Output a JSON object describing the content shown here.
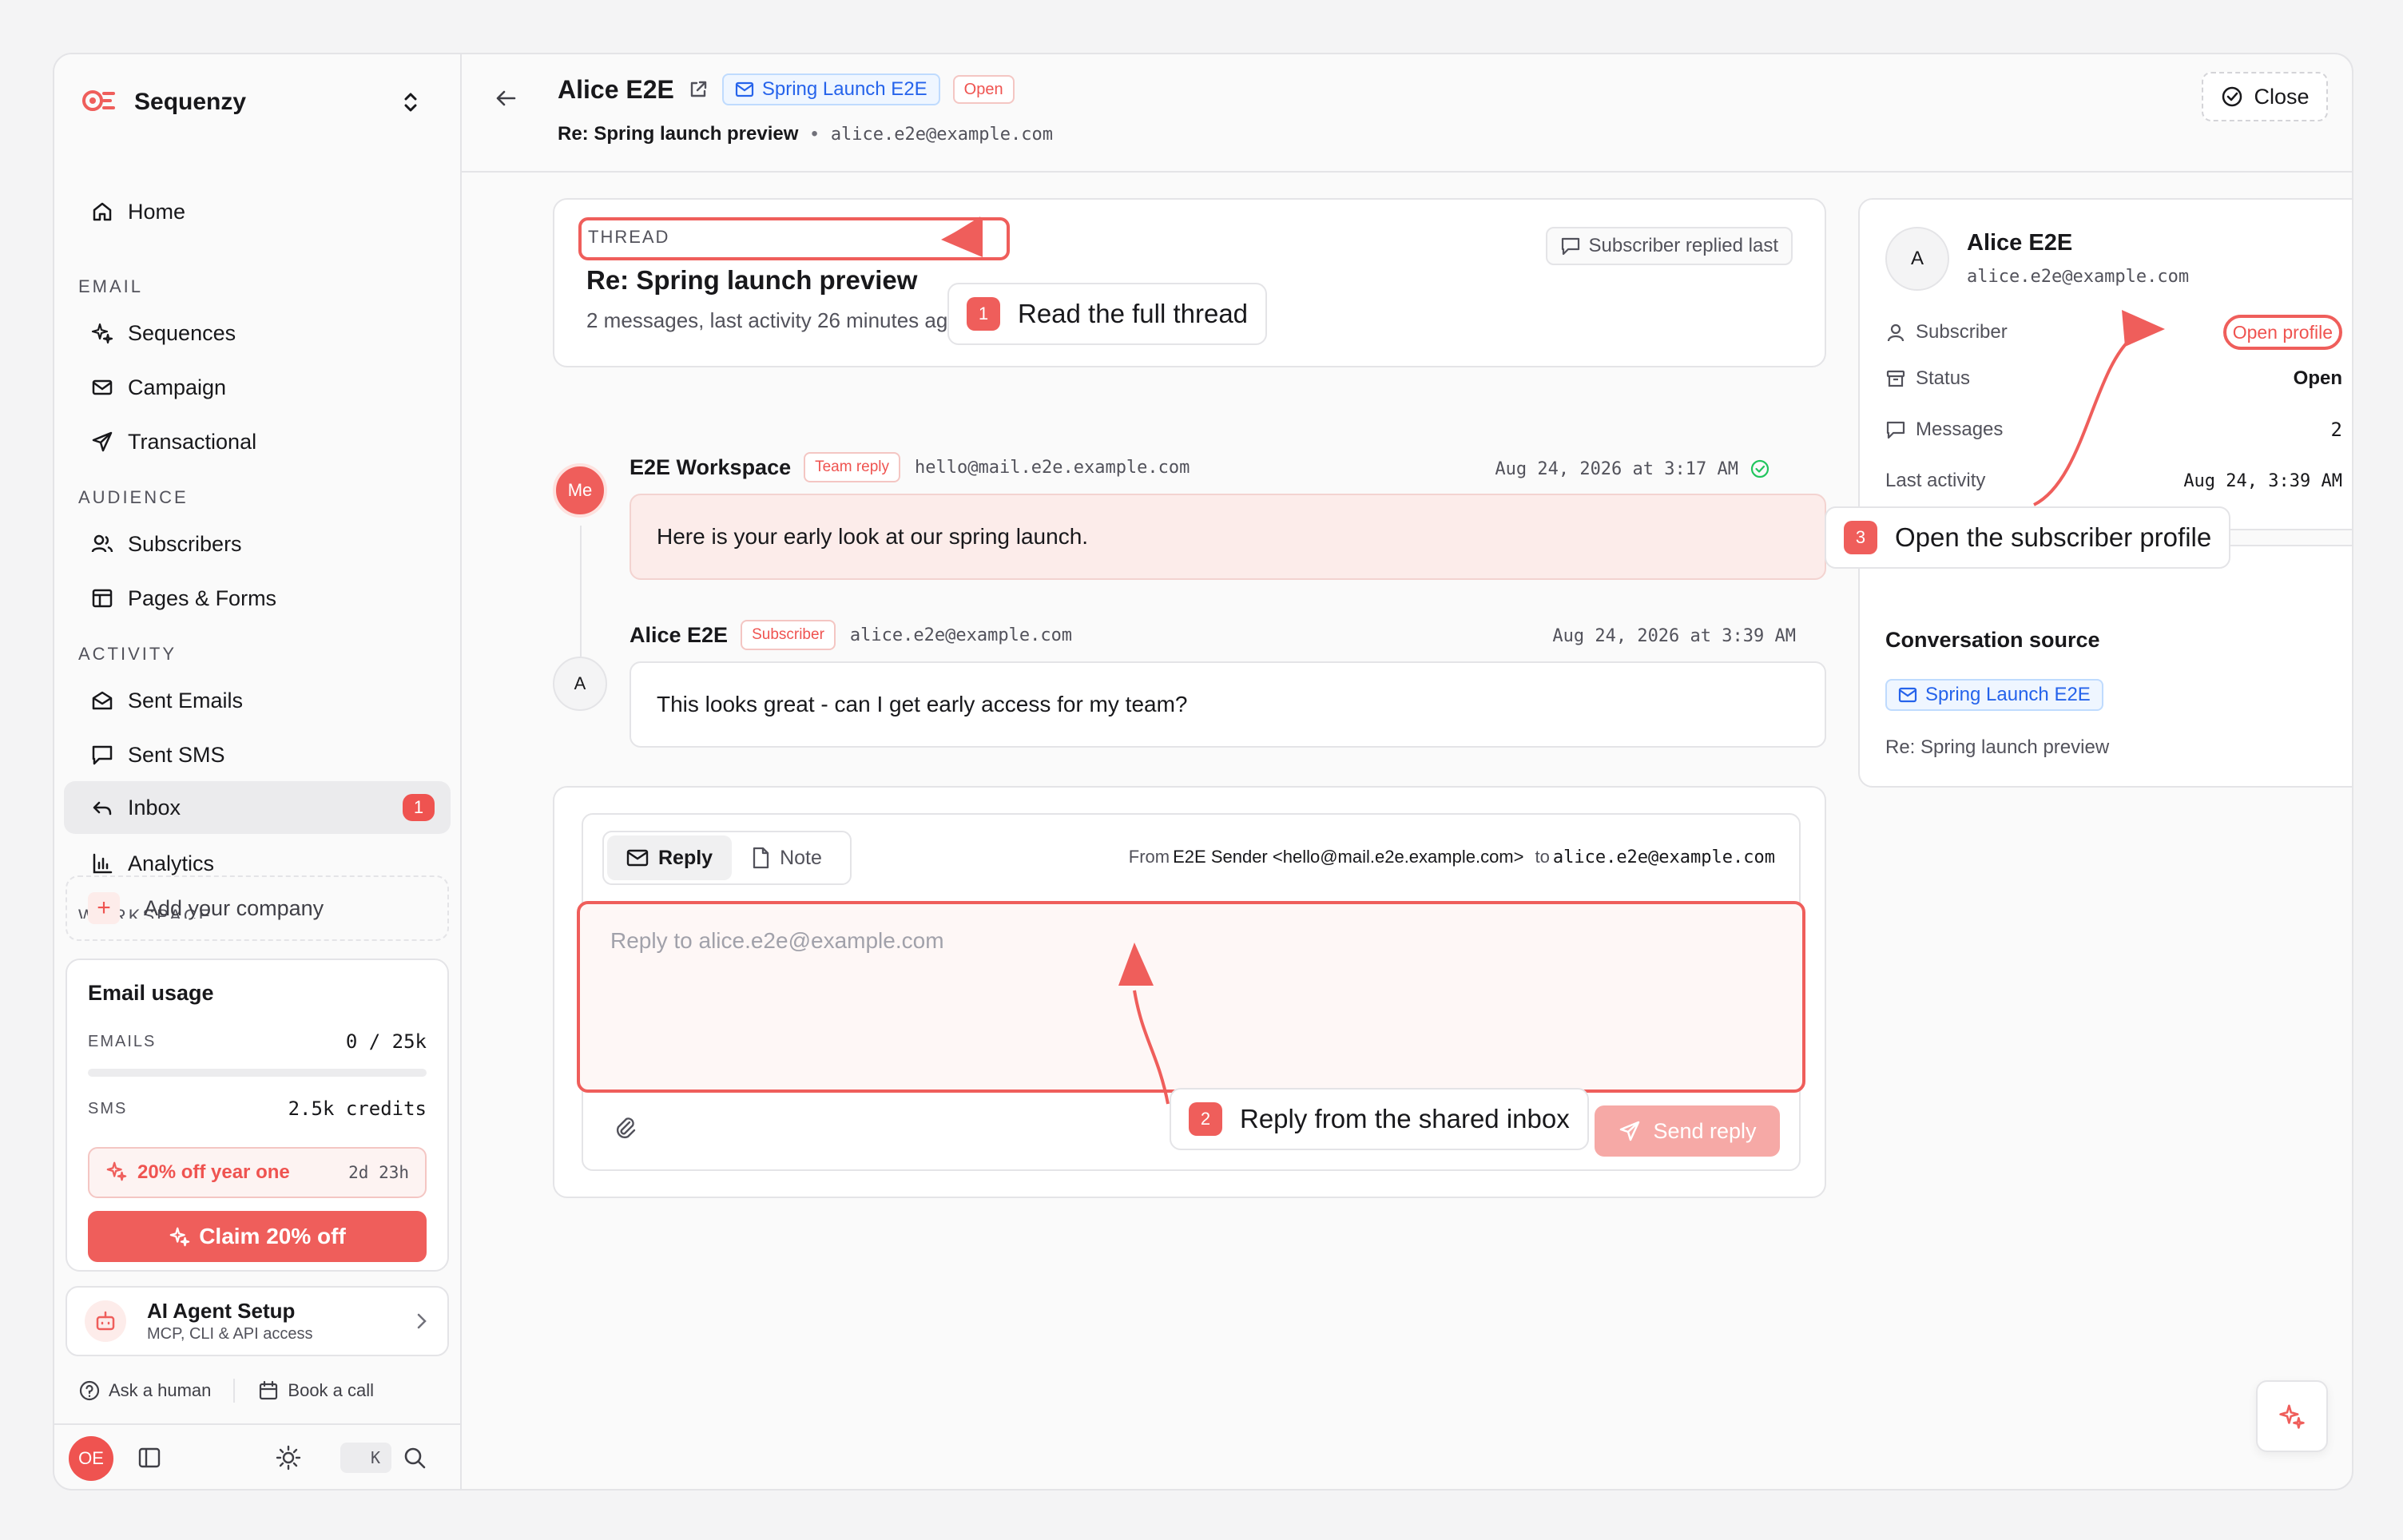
{
  "brand": {
    "name": "Sequenzy"
  },
  "sidebar": {
    "home": "Home",
    "sections": {
      "email": "EMAIL",
      "audience": "AUDIENCE",
      "activity": "ACTIVITY",
      "workspace": "WORKSPACE"
    },
    "email_items": [
      "Sequences",
      "Campaign",
      "Transactional"
    ],
    "audience_items": [
      "Subscribers",
      "Pages & Forms"
    ],
    "activity_items": [
      "Sent Emails",
      "Sent SMS",
      "Inbox",
      "Analytics"
    ],
    "inbox_badge": "1",
    "add_company": "Add your company",
    "usage": {
      "title": "Email usage",
      "emails_label": "EMAILS",
      "emails_value": "0 / 25k",
      "emails_fraction": 0,
      "sms_label": "SMS",
      "sms_value": "2.5k credits",
      "promo": "20% off year one",
      "promo_time": "2d 23h",
      "claim": "Claim 20% off"
    },
    "agent": {
      "title": "AI Agent Setup",
      "subtitle": "MCP, CLI & API access"
    },
    "ask_human": "Ask a human",
    "book_call": "Book a call",
    "avatar": "OE",
    "kbd": "K"
  },
  "header": {
    "title": "Alice E2E",
    "campaign_chip": "Spring Launch E2E",
    "status_chip": "Open",
    "subject": "Re: Spring launch preview",
    "email": "alice.e2e@example.com",
    "close": "Close"
  },
  "thread": {
    "label": "THREAD",
    "title": "Re: Spring launch preview",
    "meta": "2 messages, last activity 26 minutes ago",
    "replied_chip": "Subscriber replied last"
  },
  "messages": [
    {
      "avatar": "Me",
      "name": "E2E Workspace",
      "tag": "Team reply",
      "email": "hello@mail.e2e.example.com",
      "time": "Aug 24, 2026 at 3:17 AM",
      "body": "Here is your early look at our spring launch."
    },
    {
      "avatar": "A",
      "name": "Alice E2E",
      "tag": "Subscriber",
      "email": "alice.e2e@example.com",
      "time": "Aug 24, 2026 at 3:39 AM",
      "body": "This looks great - can I get early access for my team?"
    }
  ],
  "composer": {
    "tab_reply": "Reply",
    "tab_note": "Note",
    "from_label": "From",
    "from_value": "E2E Sender <hello@mail.e2e.example.com>",
    "to_label": "to",
    "to_value": "alice.e2e@example.com",
    "placeholder": "Reply to alice.e2e@example.com",
    "send": "Send reply"
  },
  "profile": {
    "avatar": "A",
    "name": "Alice E2E",
    "email": "alice.e2e@example.com",
    "subscriber_label": "Subscriber",
    "open_profile": "Open profile",
    "status_label": "Status",
    "status_value": "Open",
    "messages_label": "Messages",
    "messages_value": "2",
    "last_activity_label": "Last activity",
    "last_activity_value": "Aug 24, 3:39 AM"
  },
  "source": {
    "title": "Conversation source",
    "campaign": "Spring Launch E2E",
    "subject": "Re: Spring launch preview"
  },
  "callouts": [
    {
      "num": "1",
      "text": "Read the full thread"
    },
    {
      "num": "2",
      "text": "Reply from the shared inbox"
    },
    {
      "num": "3",
      "text": "Open the subscriber profile"
    }
  ],
  "colors": {
    "accent": "#ef5e5b",
    "link_blue": "#2563eb",
    "success": "#22c55e"
  }
}
